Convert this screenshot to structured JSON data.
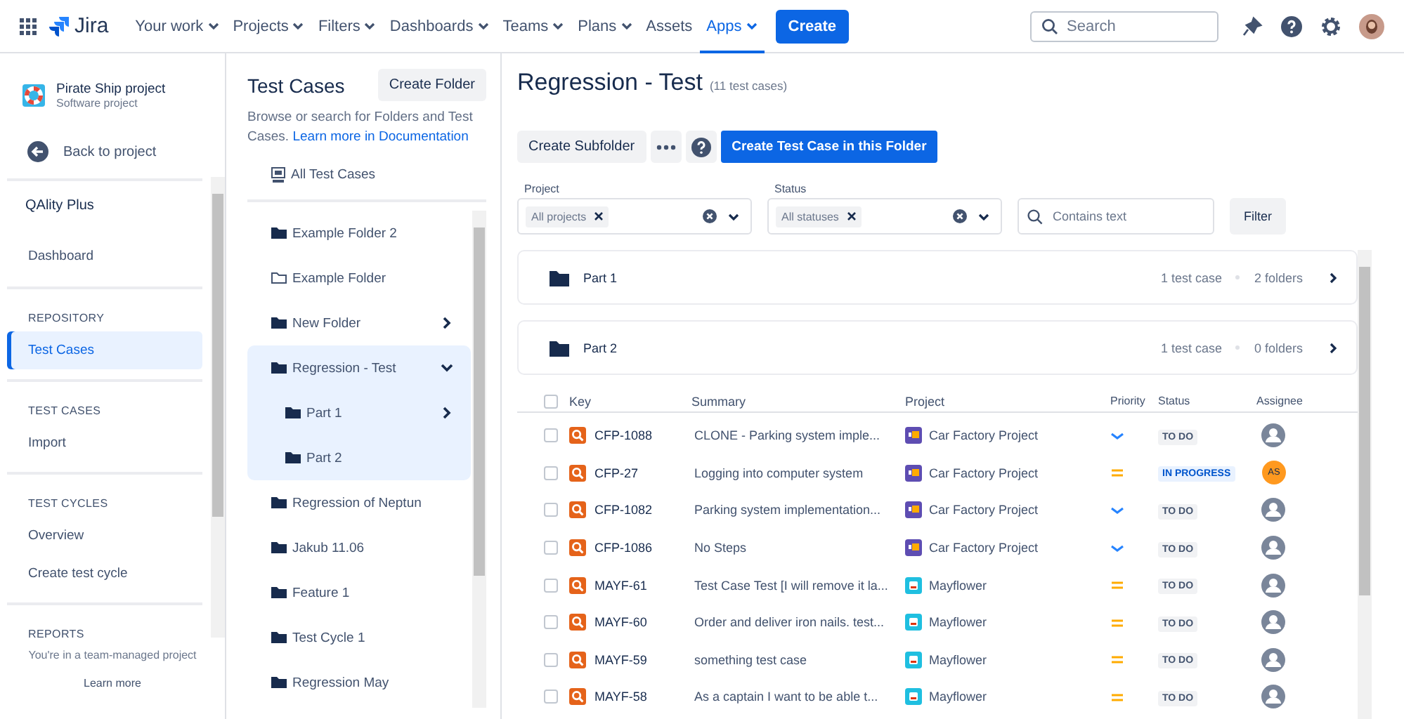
{
  "topnav": {
    "logo": "Jira",
    "items": [
      {
        "label": "Your work",
        "dropdown": true,
        "selected": false
      },
      {
        "label": "Projects",
        "dropdown": true,
        "selected": false
      },
      {
        "label": "Filters",
        "dropdown": true,
        "selected": false
      },
      {
        "label": "Dashboards",
        "dropdown": true,
        "selected": false
      },
      {
        "label": "Teams",
        "dropdown": true,
        "selected": false
      },
      {
        "label": "Plans",
        "dropdown": true,
        "selected": false
      },
      {
        "label": "Assets",
        "dropdown": false,
        "selected": false
      },
      {
        "label": "Apps",
        "dropdown": true,
        "selected": true
      }
    ],
    "create": "Create",
    "search": {
      "placeholder": "Search"
    }
  },
  "sidebar": {
    "project": {
      "name": "Pirate Ship project",
      "type": "Software project"
    },
    "back": "Back to project",
    "app": "QAlity Plus",
    "sections": [
      {
        "items": [
          {
            "label": "Dashboard",
            "selected": false
          }
        ]
      },
      {
        "heading": "REPOSITORY",
        "items": [
          {
            "label": "Test Cases",
            "selected": true
          }
        ]
      },
      {
        "heading": "TEST CASES",
        "items": [
          {
            "label": "Import",
            "selected": false
          }
        ]
      },
      {
        "heading": "TEST CYCLES",
        "items": [
          {
            "label": "Overview",
            "selected": false
          },
          {
            "label": "Create test cycle",
            "selected": false
          }
        ]
      },
      {
        "heading": "REPORTS"
      }
    ],
    "footer": {
      "text": "You're in a team-managed project",
      "link": "Learn more"
    }
  },
  "folders_panel": {
    "title": "Test Cases",
    "create": "Create Folder",
    "description": "Browse or search for Folders and Test Cases.",
    "doc_link": "Learn more in Documentation",
    "all": "All Test Cases",
    "tree": [
      {
        "label": "Example Folder 2",
        "empty": false,
        "has_children": false,
        "selected": false
      },
      {
        "label": "Example Folder",
        "empty": true,
        "has_children": false,
        "selected": false
      },
      {
        "label": "New Folder",
        "empty": false,
        "expanded": false,
        "has_children": true,
        "selected": false
      },
      {
        "label": "Regression - Test",
        "empty": false,
        "expanded": true,
        "has_children": true,
        "selected": true,
        "children": [
          {
            "label": "Part 1",
            "empty": false,
            "expanded": false,
            "has_children": true,
            "selected": false
          },
          {
            "label": "Part 2",
            "empty": false,
            "has_children": false,
            "selected": false
          }
        ]
      },
      {
        "label": "Regression of Neptun",
        "empty": false,
        "has_children": false,
        "selected": false
      },
      {
        "label": "Jakub 11.06",
        "empty": false,
        "has_children": false,
        "selected": false
      },
      {
        "label": "Feature 1",
        "empty": false,
        "has_children": false,
        "selected": false
      },
      {
        "label": "Test Cycle 1",
        "empty": false,
        "has_children": false,
        "selected": false
      },
      {
        "label": "Regression May",
        "empty": false,
        "has_children": false,
        "selected": false
      }
    ]
  },
  "main": {
    "title": "Regression - Test",
    "count": "(11 test cases)",
    "buttons": {
      "subfolder": "Create Subfolder",
      "create": "Create Test Case in this Folder"
    },
    "filters": [
      {
        "label": "Project",
        "tag": "All projects"
      },
      {
        "label": "Status",
        "tag": "All statuses"
      }
    ],
    "text_filter": {
      "placeholder": "Contains text"
    },
    "filter_button": "Filter",
    "subfolders": [
      {
        "name": "Part 1",
        "cases": "1 test case",
        "folders": "2 folders"
      },
      {
        "name": "Part 2",
        "cases": "1 test case",
        "folders": "0 folders"
      }
    ],
    "table": {
      "all_checked": false,
      "columns": [
        "Key",
        "Summary",
        "Project",
        "Priority",
        "Status",
        "Assignee"
      ],
      "rows": [
        {
          "checked": false,
          "key": "CFP-1088",
          "summary": "CLONE - Parking system imple...",
          "project": {
            "name": "Car Factory Project",
            "kind": "car"
          },
          "priority": {
            "kind": "low"
          },
          "status": {
            "label": "TO DO",
            "kind": "todo"
          }
        },
        {
          "checked": false,
          "key": "CFP-27",
          "summary": "Logging into computer system",
          "project": {
            "name": "Car Factory Project",
            "kind": "car"
          },
          "priority": {
            "kind": "medium"
          },
          "status": {
            "label": "IN PROGRESS",
            "kind": "inprogress"
          },
          "assignee": "AS"
        },
        {
          "checked": false,
          "key": "CFP-1082",
          "summary": "Parking system implementation...",
          "project": {
            "name": "Car Factory Project",
            "kind": "car"
          },
          "priority": {
            "kind": "low"
          },
          "status": {
            "label": "TO DO",
            "kind": "todo"
          }
        },
        {
          "checked": false,
          "key": "CFP-1086",
          "summary": "No Steps",
          "project": {
            "name": "Car Factory Project",
            "kind": "car"
          },
          "priority": {
            "kind": "low"
          },
          "status": {
            "label": "TO DO",
            "kind": "todo"
          }
        },
        {
          "checked": false,
          "key": "MAYF-61",
          "summary": "Test Case Test [I will remove it la...",
          "project": {
            "name": "Mayflower",
            "kind": "ship"
          },
          "priority": {
            "kind": "medium"
          },
          "status": {
            "label": "TO DO",
            "kind": "todo"
          }
        },
        {
          "checked": false,
          "key": "MAYF-60",
          "summary": "Order and deliver iron nails. test...",
          "project": {
            "name": "Mayflower",
            "kind": "ship"
          },
          "priority": {
            "kind": "medium"
          },
          "status": {
            "label": "TO DO",
            "kind": "todo"
          }
        },
        {
          "checked": false,
          "key": "MAYF-59",
          "summary": "something test case",
          "project": {
            "name": "Mayflower",
            "kind": "ship"
          },
          "priority": {
            "kind": "medium"
          },
          "status": {
            "label": "TO DO",
            "kind": "todo"
          }
        },
        {
          "checked": false,
          "key": "MAYF-58",
          "summary": "As a captain I want to be able t...",
          "project": {
            "name": "Mayflower",
            "kind": "ship"
          },
          "priority": {
            "kind": "medium"
          },
          "status": {
            "label": "TO DO",
            "kind": "todo"
          }
        }
      ]
    }
  }
}
